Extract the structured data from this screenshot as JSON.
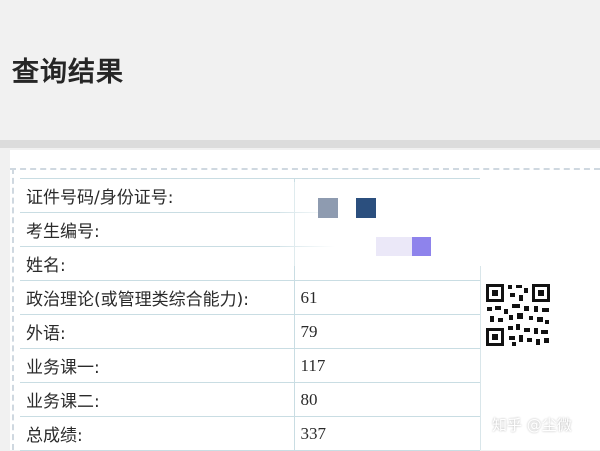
{
  "page": {
    "title": "查询结果"
  },
  "results": {
    "rows": [
      {
        "label": "证件号码/身份证号:",
        "value": ""
      },
      {
        "label": "考生编号:",
        "value": ""
      },
      {
        "label": "姓名:",
        "value": ""
      },
      {
        "label": "政治理论(或管理类综合能力):",
        "value": "61"
      },
      {
        "label": "外语:",
        "value": "79"
      },
      {
        "label": "业务课一:",
        "value": "117"
      },
      {
        "label": "业务课二:",
        "value": "80"
      },
      {
        "label": "总成绩:",
        "value": "337"
      }
    ]
  },
  "decor": {
    "mosaic_colors": [
      "#8e9bb0",
      "#2b4f7e",
      "#ebe8f8",
      "#8e83ec"
    ],
    "qr_icon": "qr-code-icon"
  },
  "watermark": {
    "text": "知乎 @尘微"
  }
}
